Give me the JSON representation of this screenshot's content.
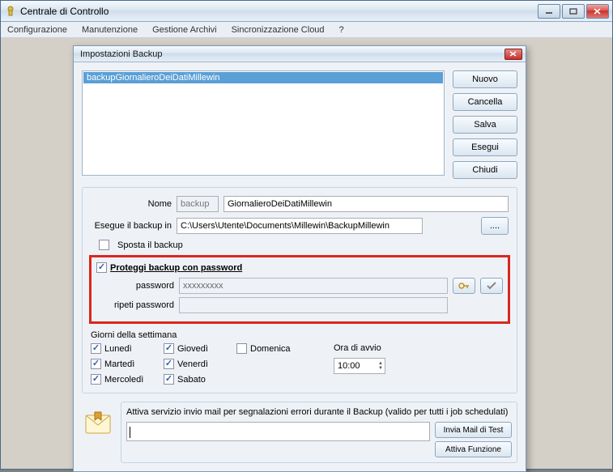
{
  "window": {
    "title": "Centrale di Controllo"
  },
  "menubar": [
    "Configurazione",
    "Manutenzione",
    "Gestione Archivi",
    "Sincronizzazione Cloud",
    "?"
  ],
  "dialog": {
    "title": "Impostazioni Backup",
    "list": [
      "backupGiornalieroDeiDatiMillewin"
    ],
    "buttons": {
      "nuovo": "Nuovo",
      "cancella": "Cancella",
      "salva": "Salva",
      "esegui": "Esegui",
      "chiudi": "Chiudi"
    },
    "form": {
      "nome_label": "Nome",
      "nome_prefix": "backup",
      "nome_value": "GiornalieroDeiDatiMillewin",
      "esegue_label": "Esegue il backup in",
      "esegue_value": "C:\\Users\\Utente\\Documents\\Millewin\\BackupMillewin",
      "browse": "....",
      "sposta_label": "Sposta il backup"
    },
    "protect": {
      "title": "Proteggi backup con password",
      "password_label": "password",
      "password_value": "xxxxxxxxx",
      "repeat_label": "ripeti  password"
    },
    "days": {
      "title": "Giorni della settimana",
      "lun": "Lunedì",
      "mar": "Martedì",
      "mer": "Mercoledì",
      "gio": "Giovedì",
      "ven": "Venerdì",
      "sab": "Sabato",
      "dom": "Domenica",
      "avvio_label": "Ora di avvio",
      "avvio_value": "10:00"
    },
    "mail": {
      "caption": "Attiva servizio invio mail per segnalazioni errori durante il Backup (valido per tutti i job schedulati)",
      "test_btn": "Invia Mail di Test",
      "attiva_btn": "Attiva Funzione"
    }
  }
}
